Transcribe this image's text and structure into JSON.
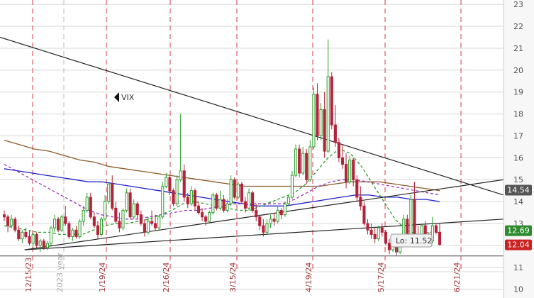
{
  "chart_data": {
    "type": "candlestick",
    "annotation": "VIX",
    "ylim": [
      9.6,
      23.2
    ],
    "grid": true,
    "yticks": [
      10,
      11,
      12,
      13,
      14,
      15,
      16,
      17,
      18,
      19,
      20,
      21,
      22,
      23
    ],
    "date_labels": [
      "12/15/23",
      "2023 year",
      "1/19/24",
      "2/16/24",
      "3/15/24",
      "4/19/24",
      "5/17/24",
      "6/21/24"
    ],
    "low_label": "Lo: 11.52",
    "price_badges": [
      {
        "label": "14.54",
        "value": 14.54,
        "color": "#555555"
      },
      {
        "label": "12.69",
        "value": 12.69,
        "color": "#2e8b2e"
      },
      {
        "label": "12.04",
        "value": 12.04,
        "color": "#cc2222"
      }
    ],
    "colors": {
      "up": "#2e9e2e",
      "down": "#b3243a",
      "grid": "#d7d7d7",
      "separator": "#d63a4a",
      "ma_short": "#2a9c2a",
      "ma_mid": "#9b30c0",
      "ma_blue": "#1f1fc8",
      "ma_brown": "#8b5a2b",
      "trend": "#222222"
    },
    "candles": [
      [
        13.4,
        13.6,
        13.1,
        13.3
      ],
      [
        13.3,
        13.4,
        12.6,
        12.9
      ],
      [
        12.9,
        13.4,
        12.8,
        13.2
      ],
      [
        13.2,
        13.3,
        12.6,
        12.7
      ],
      [
        12.7,
        12.9,
        12.2,
        12.3
      ],
      [
        12.3,
        12.7,
        12.1,
        12.6
      ],
      [
        12.6,
        12.8,
        12.3,
        12.4
      ],
      [
        12.4,
        12.7,
        12.0,
        12.1
      ],
      [
        12.1,
        12.6,
        11.9,
        12.5
      ],
      [
        12.5,
        12.6,
        11.9,
        12.0
      ],
      [
        12.0,
        12.3,
        11.7,
        12.2
      ],
      [
        12.2,
        12.3,
        11.8,
        11.9
      ],
      [
        11.9,
        12.2,
        11.8,
        12.1
      ],
      [
        12.1,
        12.9,
        12.0,
        12.8
      ],
      [
        12.8,
        13.4,
        12.6,
        13.2
      ],
      [
        13.2,
        13.3,
        12.6,
        12.7
      ],
      [
        12.7,
        13.4,
        12.6,
        13.3
      ],
      [
        13.3,
        13.8,
        12.9,
        13.0
      ],
      [
        13.0,
        13.1,
        12.3,
        12.4
      ],
      [
        12.4,
        12.8,
        12.2,
        12.7
      ],
      [
        12.7,
        12.9,
        12.3,
        12.4
      ],
      [
        12.4,
        13.2,
        12.3,
        13.1
      ],
      [
        13.1,
        13.8,
        12.9,
        13.6
      ],
      [
        13.6,
        14.4,
        13.5,
        14.2
      ],
      [
        14.2,
        14.4,
        13.2,
        13.3
      ],
      [
        13.3,
        13.5,
        12.8,
        12.9
      ],
      [
        12.9,
        13.1,
        12.3,
        12.5
      ],
      [
        12.5,
        13.3,
        12.4,
        13.2
      ],
      [
        13.2,
        14.3,
        13.1,
        14.0
      ],
      [
        14.0,
        14.9,
        13.9,
        14.8
      ],
      [
        14.8,
        15.2,
        13.6,
        13.7
      ],
      [
        13.7,
        14.0,
        13.0,
        13.1
      ],
      [
        13.1,
        13.5,
        12.6,
        12.8
      ],
      [
        12.8,
        13.7,
        12.7,
        13.6
      ],
      [
        13.6,
        14.6,
        13.5,
        14.4
      ],
      [
        14.4,
        14.6,
        13.2,
        13.3
      ],
      [
        13.3,
        14.1,
        13.2,
        13.9
      ],
      [
        13.9,
        14.0,
        13.2,
        13.4
      ],
      [
        13.4,
        13.6,
        12.9,
        13.0
      ],
      [
        13.0,
        13.2,
        12.4,
        12.6
      ],
      [
        12.6,
        13.3,
        12.5,
        13.1
      ],
      [
        13.1,
        13.6,
        12.9,
        13.0
      ],
      [
        13.0,
        13.4,
        12.7,
        12.8
      ],
      [
        12.8,
        13.4,
        12.7,
        13.3
      ],
      [
        13.3,
        14.9,
        13.2,
        14.7
      ],
      [
        14.7,
        15.3,
        14.6,
        15.1
      ],
      [
        15.1,
        15.2,
        14.3,
        14.5
      ],
      [
        14.5,
        14.6,
        13.8,
        13.9
      ],
      [
        13.9,
        15.2,
        13.8,
        15.0
      ],
      [
        15.0,
        18.0,
        14.9,
        15.4
      ],
      [
        15.4,
        15.7,
        14.0,
        14.2
      ],
      [
        14.2,
        14.4,
        13.7,
        13.9
      ],
      [
        13.9,
        14.7,
        13.8,
        14.5
      ],
      [
        14.5,
        14.6,
        13.6,
        13.8
      ],
      [
        13.8,
        14.0,
        13.4,
        13.5
      ],
      [
        13.5,
        13.7,
        13.1,
        13.3
      ],
      [
        13.3,
        13.4,
        12.9,
        13.1
      ],
      [
        13.1,
        13.6,
        13.0,
        13.5
      ],
      [
        13.5,
        14.4,
        13.4,
        14.3
      ],
      [
        14.3,
        14.4,
        13.6,
        13.7
      ],
      [
        13.7,
        14.5,
        13.6,
        14.1
      ],
      [
        14.1,
        14.3,
        13.5,
        13.6
      ],
      [
        13.6,
        14.1,
        13.5,
        13.9
      ],
      [
        13.9,
        15.2,
        13.8,
        15.0
      ],
      [
        15.0,
        15.1,
        14.1,
        14.2
      ],
      [
        14.2,
        14.9,
        14.1,
        14.8
      ],
      [
        14.8,
        14.9,
        13.9,
        14.0
      ],
      [
        14.0,
        14.2,
        13.5,
        13.7
      ],
      [
        13.7,
        14.6,
        13.6,
        14.4
      ],
      [
        14.4,
        14.5,
        13.5,
        13.6
      ],
      [
        13.6,
        13.9,
        13.1,
        13.3
      ],
      [
        13.3,
        13.4,
        12.7,
        12.9
      ],
      [
        12.9,
        13.2,
        12.4,
        12.6
      ],
      [
        12.6,
        13.2,
        12.5,
        13.0
      ],
      [
        13.0,
        13.4,
        12.8,
        13.2
      ],
      [
        13.2,
        13.5,
        12.9,
        13.1
      ],
      [
        13.1,
        13.8,
        13.0,
        13.6
      ],
      [
        13.6,
        13.7,
        13.2,
        13.4
      ],
      [
        13.4,
        14.0,
        13.3,
        13.9
      ],
      [
        13.9,
        14.3,
        13.8,
        14.2
      ],
      [
        14.2,
        15.4,
        14.1,
        15.2
      ],
      [
        15.2,
        16.6,
        15.1,
        16.4
      ],
      [
        16.4,
        16.6,
        15.1,
        15.3
      ],
      [
        15.3,
        16.5,
        15.2,
        16.2
      ],
      [
        16.2,
        16.4,
        14.8,
        15.0
      ],
      [
        15.0,
        16.8,
        14.9,
        16.5
      ],
      [
        16.5,
        19.2,
        16.4,
        18.9
      ],
      [
        18.9,
        19.4,
        16.8,
        17.0
      ],
      [
        17.0,
        18.5,
        16.8,
        18.2
      ],
      [
        18.2,
        19.0,
        16.0,
        16.3
      ],
      [
        16.3,
        21.4,
        16.2,
        19.7
      ],
      [
        19.7,
        19.9,
        17.3,
        17.5
      ],
      [
        17.5,
        18.4,
        16.5,
        16.7
      ],
      [
        16.7,
        16.9,
        15.8,
        16.0
      ],
      [
        16.0,
        16.6,
        15.5,
        15.7
      ],
      [
        15.7,
        16.2,
        14.6,
        14.9
      ],
      [
        14.9,
        16.1,
        14.8,
        15.9
      ],
      [
        15.9,
        16.0,
        14.7,
        15.0
      ],
      [
        15.0,
        15.2,
        14.0,
        14.2
      ],
      [
        14.2,
        14.7,
        13.6,
        13.8
      ],
      [
        13.8,
        14.0,
        12.9,
        13.0
      ],
      [
        13.0,
        13.2,
        12.5,
        12.7
      ],
      [
        12.7,
        13.0,
        12.3,
        12.5
      ],
      [
        12.5,
        12.8,
        12.1,
        12.3
      ],
      [
        12.3,
        12.9,
        12.2,
        12.8
      ],
      [
        12.8,
        13.0,
        12.4,
        12.6
      ],
      [
        12.6,
        12.7,
        12.0,
        12.1
      ],
      [
        12.1,
        12.3,
        11.6,
        11.8
      ],
      [
        11.8,
        12.2,
        11.7,
        12.0
      ],
      [
        12.0,
        12.1,
        11.52,
        11.7
      ],
      [
        11.7,
        12.5,
        11.6,
        12.4
      ],
      [
        12.4,
        13.4,
        12.3,
        13.2
      ],
      [
        13.2,
        13.4,
        12.4,
        12.5
      ],
      [
        12.5,
        14.3,
        12.4,
        14.1
      ],
      [
        14.1,
        14.9,
        12.3,
        12.5
      ],
      [
        12.5,
        12.9,
        12.1,
        12.3
      ],
      [
        12.3,
        13.0,
        12.2,
        12.9
      ],
      [
        12.9,
        13.1,
        12.3,
        12.4
      ],
      [
        12.4,
        12.6,
        12.0,
        12.2
      ],
      [
        12.2,
        13.3,
        12.1,
        12.9
      ],
      [
        12.9,
        13.0,
        12.5,
        12.6
      ],
      [
        12.6,
        13.0,
        12.0,
        12.04
      ]
    ],
    "ma_short": [
      12.9,
      12.8,
      12.7,
      12.6,
      12.6,
      12.5,
      12.5,
      12.5,
      12.7,
      12.9,
      13.0,
      13.0,
      13.1,
      13.2,
      13.4,
      13.6,
      13.9,
      14.0,
      13.9,
      13.8,
      13.7,
      13.6,
      13.6,
      13.8,
      14.0,
      14.2,
      14.4,
      14.8,
      15.4,
      16.0,
      16.4,
      16.2,
      15.6,
      14.8,
      14.0,
      13.2,
      12.7,
      12.5,
      12.6,
      12.6
    ],
    "ma_mid": [
      15.7,
      15.4,
      15.1,
      14.8,
      14.5,
      14.2,
      13.9,
      13.6,
      13.4,
      13.3,
      13.2,
      13.2,
      13.3,
      13.4,
      13.5,
      13.6,
      13.6,
      13.7,
      13.8,
      13.9,
      13.9,
      13.9,
      13.9,
      13.9,
      14.1,
      14.4,
      14.7,
      14.9,
      15.0,
      15.0,
      14.9,
      14.8,
      14.7,
      14.6,
      14.5,
      14.4,
      14.3
    ],
    "ma_blue": [
      15.5,
      15.4,
      15.3,
      15.2,
      15.1,
      15.0,
      14.9,
      14.9,
      14.8,
      14.7,
      14.6,
      14.5,
      14.4,
      14.3,
      14.2,
      14.1,
      14.0,
      13.9,
      13.8,
      13.8,
      13.8,
      13.9,
      14.0,
      14.1,
      14.2,
      14.3,
      14.3,
      14.2,
      14.2,
      14.1,
      14.1,
      14.0
    ],
    "ma_brown": [
      16.8,
      16.6,
      16.4,
      16.3,
      16.1,
      15.9,
      15.8,
      15.6,
      15.5,
      15.4,
      15.3,
      15.2,
      15.1,
      15.0,
      14.9,
      14.8,
      14.7,
      14.7,
      14.7,
      14.7,
      14.7,
      14.7,
      14.8,
      14.9,
      14.9,
      14.9,
      14.8,
      14.7,
      14.6,
      14.5
    ],
    "trendlines": [
      {
        "from": [
          0,
          21.5
        ],
        "to": [
          1,
          14.3
        ]
      },
      {
        "from": [
          0.049,
          11.8
        ],
        "to": [
          1,
          15.0
        ]
      },
      {
        "from": [
          0.049,
          11.8
        ],
        "to": [
          1,
          13.2
        ]
      }
    ],
    "support_level": 11.52
  }
}
